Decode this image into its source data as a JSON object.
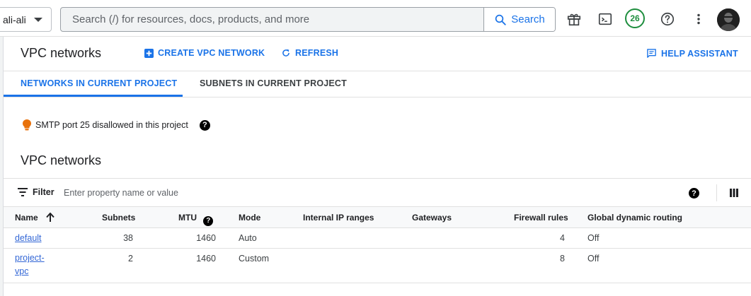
{
  "topbar": {
    "project": "ali-ali",
    "search_placeholder": "Search (/) for resources, docs, products, and more",
    "search_button": "Search",
    "notifications_count": "26"
  },
  "header": {
    "title": "VPC networks",
    "create_label": "CREATE VPC NETWORK",
    "refresh_label": "REFRESH",
    "help_assistant_label": "HELP ASSISTANT"
  },
  "tabs": [
    {
      "label": "NETWORKS IN CURRENT PROJECT",
      "active": true
    },
    {
      "label": "SUBNETS IN CURRENT PROJECT",
      "active": false
    }
  ],
  "notice": {
    "text": "SMTP port 25 disallowed in this project"
  },
  "section": {
    "title": "VPC networks"
  },
  "filter": {
    "label": "Filter",
    "placeholder": "Enter property name or value"
  },
  "table": {
    "columns": [
      "Name",
      "Subnets",
      "MTU",
      "Mode",
      "Internal IP ranges",
      "Gateways",
      "Firewall rules",
      "Global dynamic routing"
    ],
    "rows": [
      {
        "name": "default",
        "subnets": "38",
        "mtu": "1460",
        "mode": "Auto",
        "internal_ip_ranges": "",
        "gateways": "",
        "firewall_rules": "4",
        "global_dynamic_routing": "Off"
      },
      {
        "name": "project-vpc",
        "name_line1": "project-",
        "name_line2": "vpc",
        "subnets": "2",
        "mtu": "1460",
        "mode": "Custom",
        "internal_ip_ranges": "",
        "gateways": "",
        "firewall_rules": "8",
        "global_dynamic_routing": "Off"
      }
    ]
  },
  "colors": {
    "accent": "#1a73e8",
    "badge_green": "#1e8e3e",
    "notice_orange": "#e8710a"
  }
}
